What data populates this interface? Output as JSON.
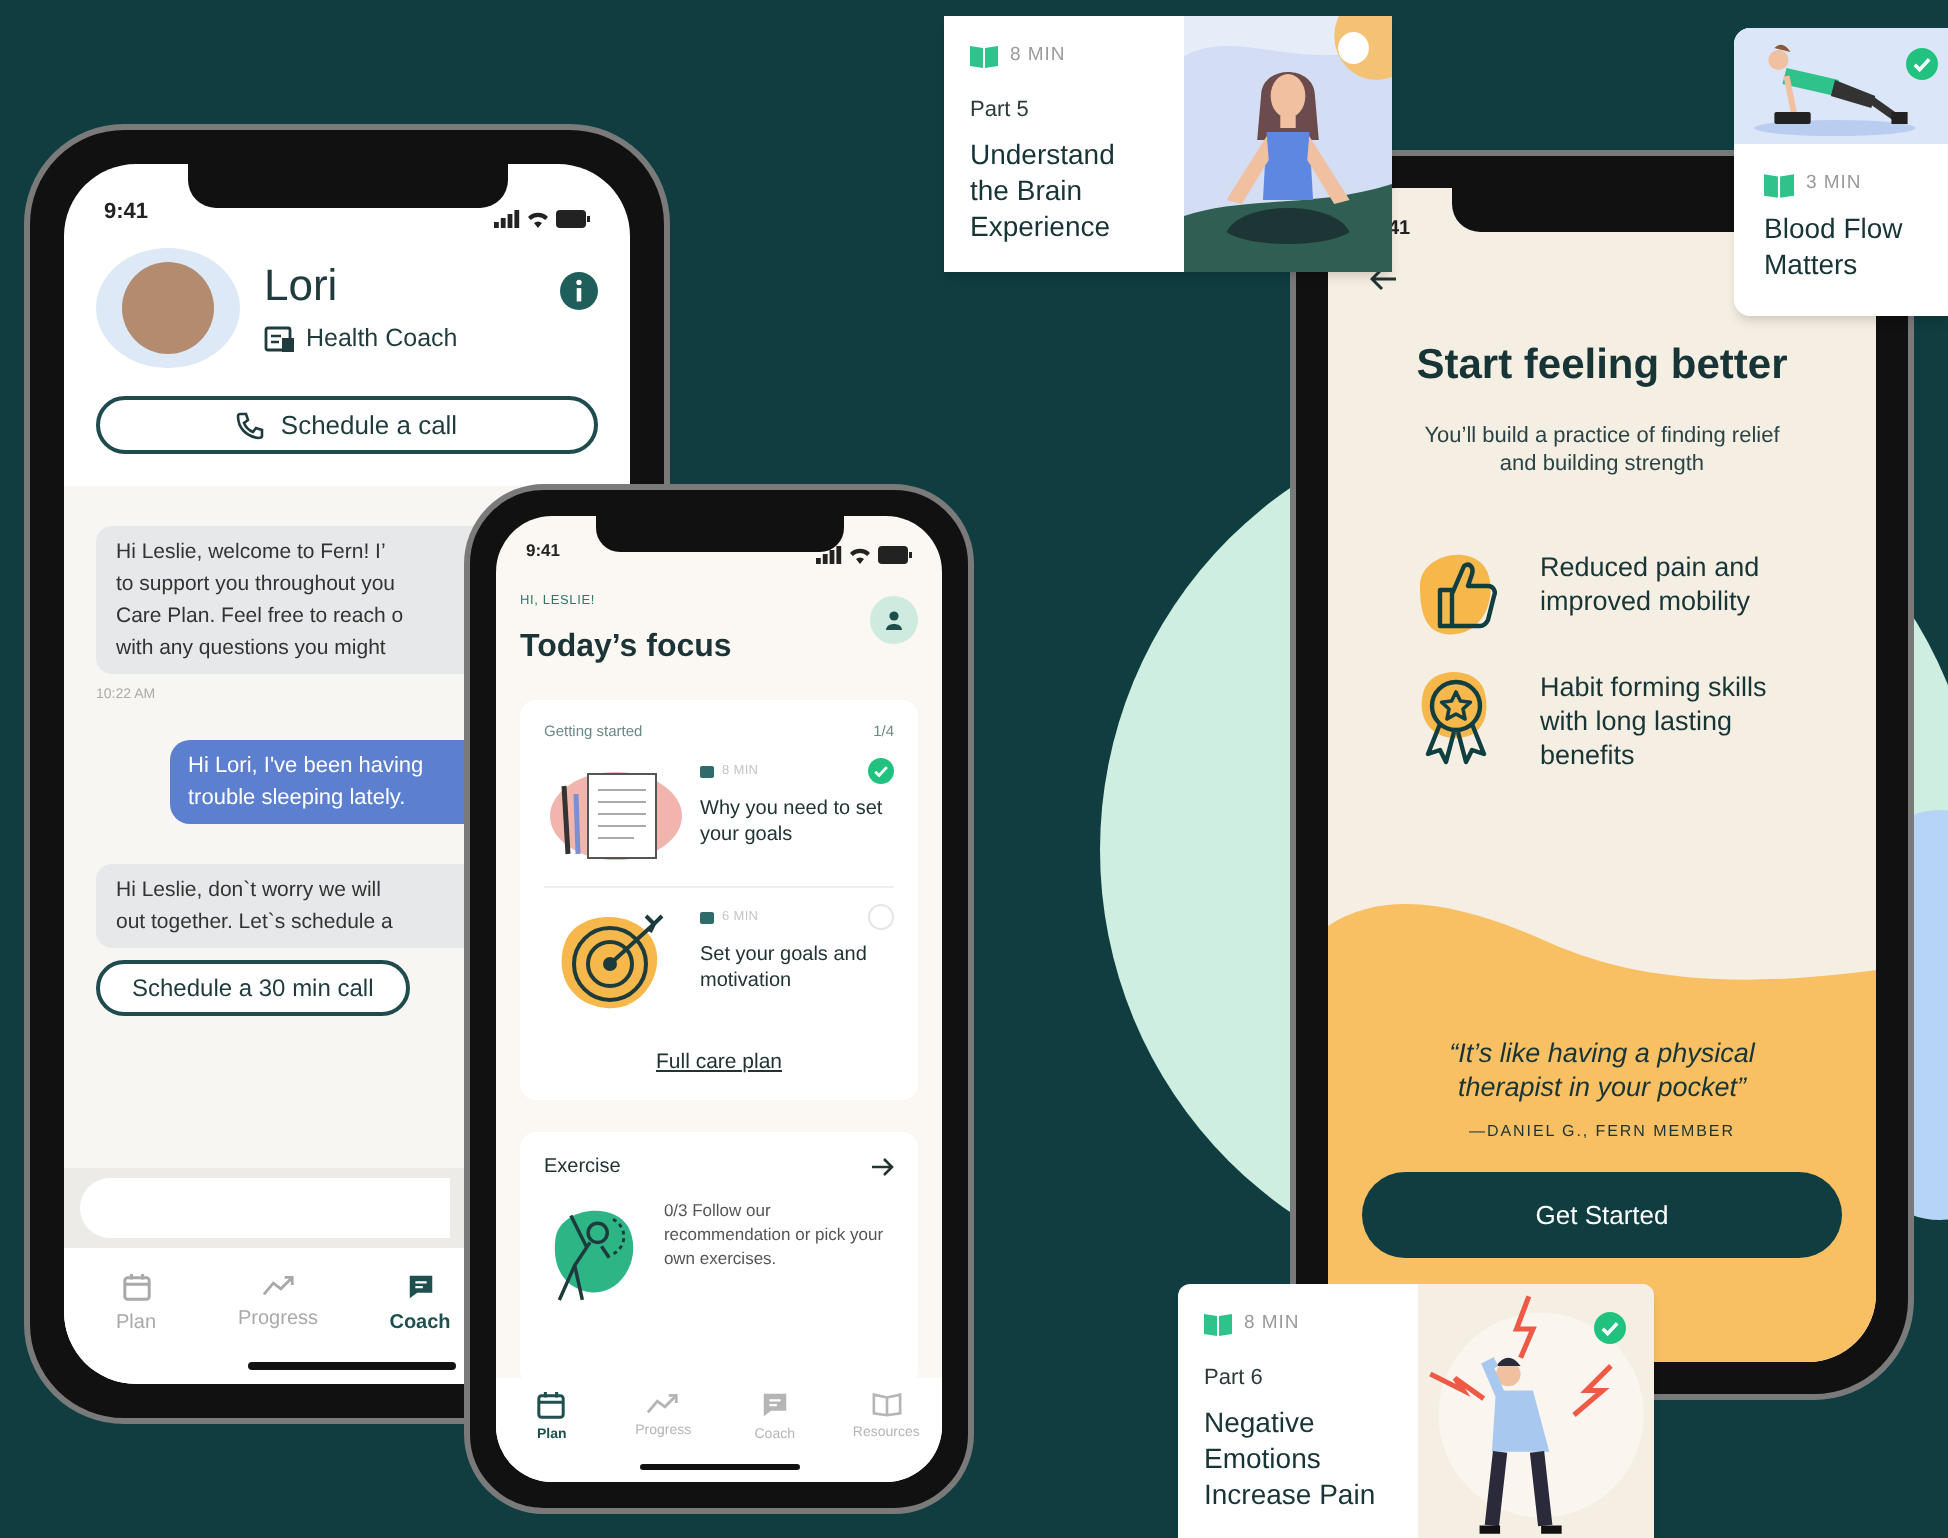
{
  "coach_screen": {
    "status_time": "9:41",
    "coach_name": "Lori",
    "coach_role": "Health Coach",
    "schedule_button": "Schedule a call",
    "messages": [
      {
        "kind": "received",
        "text": "Hi Leslie, welcome to Fern! I’\nto support you throughout you\nCare Plan. Feel free to reach o\nwith any questions you might"
      },
      {
        "kind": "timestamp",
        "text": "10:22 AM"
      },
      {
        "kind": "sent",
        "text": "Hi Lori, I've been having\ntrouble sleeping lately."
      },
      {
        "kind": "received",
        "text": "Hi Leslie, don`t worry we will\nout together. Let`s schedule a"
      },
      {
        "kind": "action",
        "text": "Schedule a 30 min call"
      }
    ],
    "tabs": [
      {
        "kind": "calendar",
        "label": "Plan",
        "selected": false
      },
      {
        "kind": "trend",
        "label": "Progress",
        "selected": false
      },
      {
        "kind": "chat",
        "label": "Coach",
        "selected": true
      }
    ]
  },
  "plan_screen": {
    "status_time": "9:41",
    "greeting": "HI, LESLIE!",
    "title": "Today’s focus",
    "getting_started": {
      "label": "Getting started",
      "progress": "1/4",
      "items": [
        {
          "kind": "notebook",
          "duration": "8 MIN",
          "title": "Why you need to set your goals",
          "done": true
        },
        {
          "kind": "target",
          "duration": "6 MIN",
          "title": "Set your goals and motivation",
          "done": false
        }
      ],
      "link": "Full care plan"
    },
    "exercise": {
      "title": "Exercise",
      "text": "0/3 Follow our recommendation or pick your own exercises."
    },
    "tabs": [
      {
        "kind": "calendar",
        "label": "Plan",
        "selected": true
      },
      {
        "kind": "trend",
        "label": "Progress",
        "selected": false
      },
      {
        "kind": "chat",
        "label": "Coach",
        "selected": false
      },
      {
        "kind": "book",
        "label": "Resources",
        "selected": false
      }
    ]
  },
  "onboarding_screen": {
    "status_time": "41",
    "title": "Start feeling better",
    "subtitle": "You’ll build a practice of finding relief and building strength",
    "benefits": [
      {
        "kind": "thumbs-up",
        "text": "Reduced pain and improved mobility"
      },
      {
        "kind": "award",
        "text": "Habit forming skills with long lasting benefits"
      }
    ],
    "quote": "“It’s like having a physical therapist in your pocket”",
    "attribution": "—DANIEL G., FERN MEMBER",
    "button": "Get Started"
  },
  "lesson_cards": [
    {
      "kind": "meditation",
      "duration": "8 MIN",
      "part": "Part 5",
      "title": "Understand the Brain Experience",
      "checked": false
    },
    {
      "kind": "pushup",
      "duration": "3 MIN",
      "title": "Blood Flow Matters",
      "checked": true
    },
    {
      "kind": "headache",
      "duration": "8 MIN",
      "part": "Part 6",
      "title": "Negative Emotions Increase Pain",
      "checked": true
    }
  ]
}
